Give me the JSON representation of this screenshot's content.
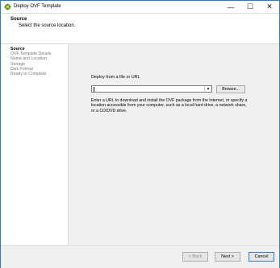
{
  "window": {
    "title": "Deploy OVF Template",
    "minimize_glyph": "—",
    "maximize_glyph": "☐",
    "close_glyph": "✕"
  },
  "header": {
    "title": "Source",
    "subtitle": "Select the source location."
  },
  "steps": [
    {
      "label": "Source",
      "active": true
    },
    {
      "label": "OVF Template Details",
      "active": false
    },
    {
      "label": "Name and Location",
      "active": false
    },
    {
      "label": "Storage",
      "active": false
    },
    {
      "label": "Disk Format",
      "active": false
    },
    {
      "label": "Ready to Complete",
      "active": false
    }
  ],
  "content": {
    "deploy_label": "Deploy from a file or URL",
    "source_value": "",
    "browse_label": "Browse...",
    "help_text": "Enter a URL to download and install the OVF package from the Internet, or specify a location accessible from your computer, such as a local hard drive, a network share, or a CD/DVD drive."
  },
  "footer": {
    "back_label": "< Back",
    "next_label": "Next >",
    "cancel_label": "Cancel"
  },
  "colors": {
    "accent": "#2b79d1"
  }
}
